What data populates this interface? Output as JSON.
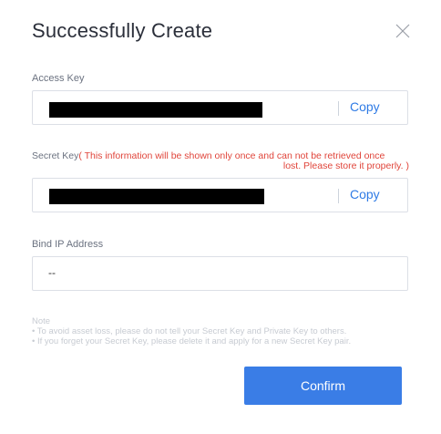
{
  "dialog": {
    "title": "Successfully Create",
    "close_icon": "close-icon"
  },
  "access_key": {
    "label": "Access Key",
    "value_redacted": true,
    "copy_label": "Copy"
  },
  "secret_key": {
    "label": "Secret Key",
    "warning_line1": "( This information will be shown only once and can not be retrieved once",
    "warning_line2": "lost. Please store it properly. )",
    "value_redacted": true,
    "copy_label": "Copy"
  },
  "bind_ip": {
    "label": "Bind IP Address",
    "value": "--"
  },
  "note": {
    "title": "Note",
    "items": [
      "• To avoid asset loss, please do not tell your Secret Key and Private Key to others.",
      "• If you forget your Secret Key, please delete it and apply for a new Secret Key pair."
    ]
  },
  "confirm_label": "Confirm",
  "colors": {
    "accent": "#3a7de6",
    "link": "#2f7be5",
    "warning": "#e0443a",
    "note_text": "#c7cbd2"
  }
}
